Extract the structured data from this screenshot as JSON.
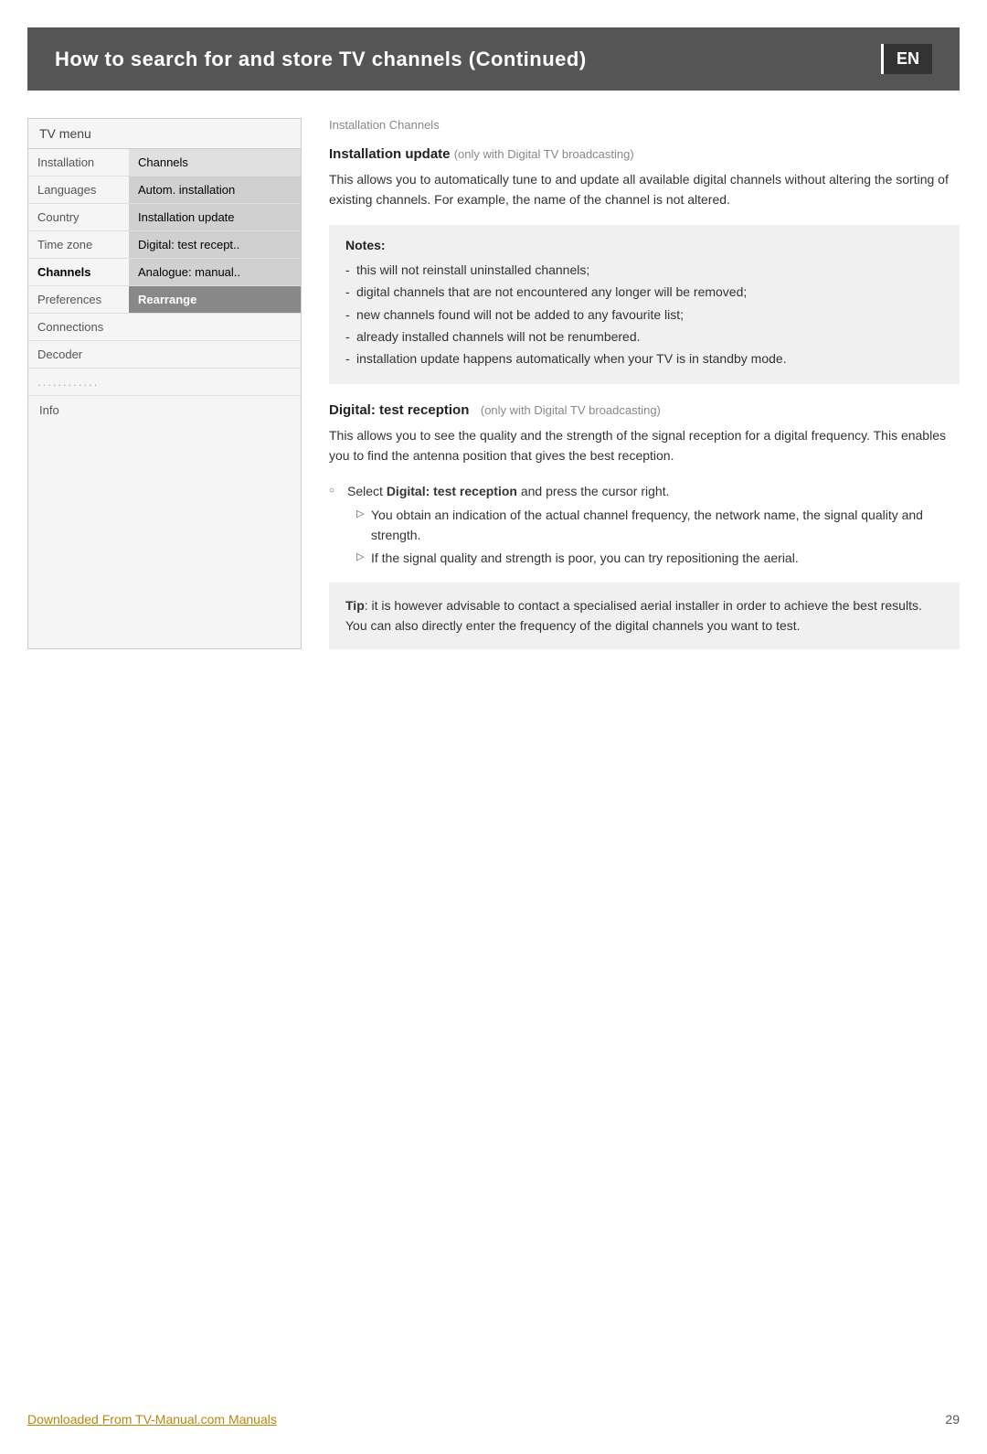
{
  "header": {
    "title": "How to search for and store TV channels  (Continued)",
    "en_badge": "EN"
  },
  "menu": {
    "header_label": "TV menu",
    "rows": [
      {
        "left": "Installation",
        "right": "Channels",
        "right_style": "normal"
      },
      {
        "left": "Languages",
        "right": "Autom. installation",
        "right_style": "light-gray"
      },
      {
        "left": "Country",
        "right": "Installation update",
        "right_style": "light-gray"
      },
      {
        "left": "Time zone",
        "right": "Digital: test recept..",
        "right_style": "light-gray"
      },
      {
        "left": "Channels",
        "right": "Analogue: manual..",
        "right_style": "light-gray",
        "left_selected": true
      },
      {
        "left": "Preferences",
        "right": "Rearrange",
        "right_style": "highlighted"
      },
      {
        "left": "Connections",
        "right": "",
        "right_style": "empty"
      },
      {
        "left": "Decoder",
        "right": "",
        "right_style": "empty"
      }
    ],
    "dots": "............",
    "info": "Info"
  },
  "installation_channels": {
    "label": "Installation Channels"
  },
  "installation_update": {
    "title": "Installation update",
    "subtitle": "(only with Digital TV broadcasting)",
    "body": "This allows you to automatically tune to and update all available digital channels without altering the sorting of existing channels. For example, the name of the channel is not altered.",
    "notes_title": "Notes:",
    "notes": [
      "this will not reinstall uninstalled channels;",
      "digital channels that are not encountered any longer will be removed;",
      "new channels found will not be added to any favourite list;",
      "already installed channels will not be renumbered.",
      "installation update happens automatically when your TV is in standby mode."
    ]
  },
  "digital_test": {
    "title": "Digital: test reception",
    "subtitle": "(only with Digital TV broadcasting)",
    "body": "This allows you to see the quality and the strength of the signal reception for a digital frequency. This enables you to find the antenna position that gives the best reception.",
    "bullet_label": "Select",
    "bullet_bold": "Digital: test reception",
    "bullet_suffix": "and press the cursor right.",
    "sub_items": [
      "You obtain an indication of the actual channel frequency, the network name, the signal quality and strength.",
      "If the signal quality and strength is poor, you can try repositioning the aerial."
    ],
    "tip_label": "Tip",
    "tip_text": ": it is however advisable to contact a specialised aerial installer in order to achieve the best results.\nYou can also directly enter the frequency of the digital channels you want to test."
  },
  "footer": {
    "link_text": "Downloaded From TV-Manual.com Manuals",
    "page_number": "29"
  }
}
